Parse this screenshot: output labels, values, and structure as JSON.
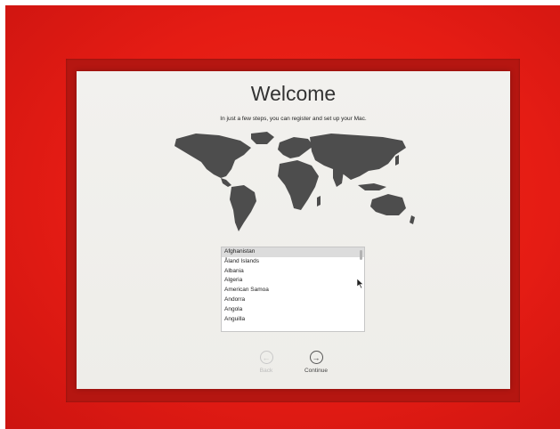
{
  "welcome": {
    "title": "Welcome",
    "subtitle": "In just a few steps, you can register and set up your Mac."
  },
  "country_list": {
    "items": [
      "Afghanistan",
      "Åland Islands",
      "Albania",
      "Algeria",
      "American Samoa",
      "Andorra",
      "Angola",
      "Anguilla"
    ],
    "selected": "Afghanistan"
  },
  "nav": {
    "back_label": "Back",
    "continue_label": "Continue",
    "back_icon": "arrow-left-icon",
    "continue_icon": "arrow-right-icon"
  },
  "colors": {
    "background": "#e51c14",
    "screen": "#f2f1ee",
    "map": "#4d4d4d"
  }
}
